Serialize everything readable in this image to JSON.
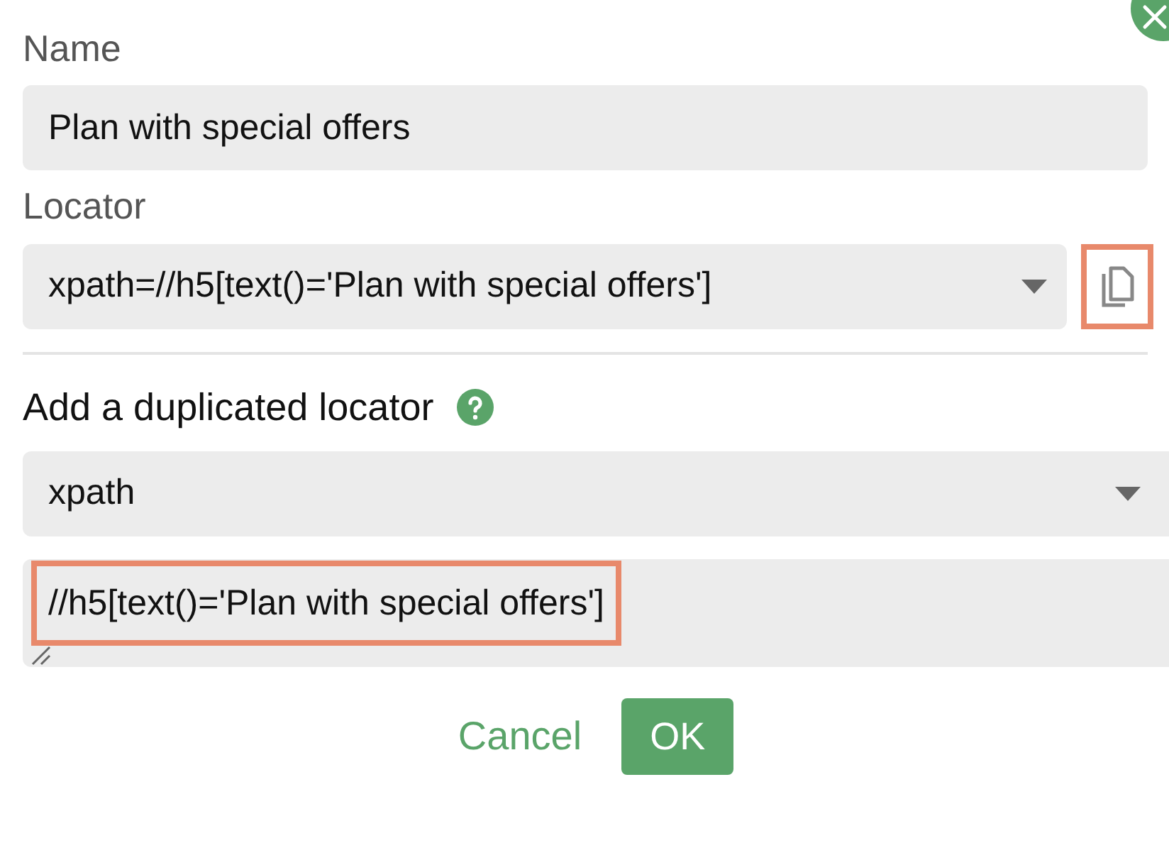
{
  "name_field": {
    "label": "Name",
    "value": "Plan with special offers"
  },
  "locator": {
    "label": "Locator",
    "value": "xpath=//h5[text()='Plan with special offers']",
    "copy_highlighted": true
  },
  "duplicate": {
    "title": "Add a duplicated locator",
    "strategy": "xpath",
    "value": "//h5[text()='Plan with special offers']",
    "value_highlighted": true
  },
  "buttons": [
    {
      "kind": "link",
      "label": "Cancel"
    },
    {
      "kind": "primary",
      "label": "OK"
    }
  ]
}
